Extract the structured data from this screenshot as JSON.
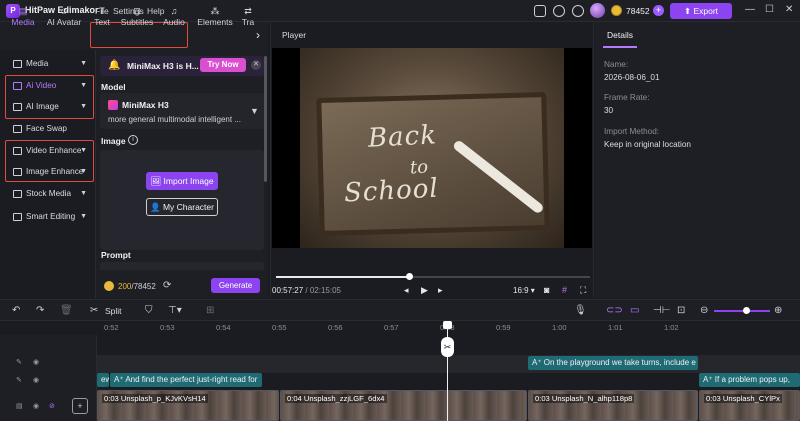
{
  "app": {
    "title": "HitPaw Edimakor",
    "logo": "P",
    "menu": [
      "File",
      "Settings",
      "Help"
    ]
  },
  "account": {
    "coins": "78452",
    "plus": "+",
    "export_label": "Export"
  },
  "left_tabs": [
    {
      "label": "Media",
      "icon": "media-icon"
    },
    {
      "label": "AI Avatar",
      "icon": "ai-avatar-icon"
    },
    {
      "label": "Text",
      "icon": "text-icon"
    },
    {
      "label": "Subtitles",
      "icon": "subtitles-icon"
    },
    {
      "label": "Audio",
      "icon": "audio-icon"
    },
    {
      "label": "Elements",
      "icon": "elements-icon"
    },
    {
      "label": "Tra",
      "icon": "transitions-icon"
    }
  ],
  "sidebar": [
    {
      "label": "Media"
    },
    {
      "label": "Ai Video"
    },
    {
      "label": "AI Image"
    },
    {
      "label": "Face Swap"
    },
    {
      "label": "Video Enhance"
    },
    {
      "label": "Image Enhance"
    },
    {
      "label": "Stock Media"
    },
    {
      "label": "Smart Editing"
    }
  ],
  "promo": {
    "text": "MiniMax H3 is H...",
    "cta": "Try Now"
  },
  "model": {
    "section": "Model",
    "name": "MiniMax H3",
    "desc": "more general multimodal intelligent ..."
  },
  "image_section": {
    "label": "Image",
    "import_label": "Import Image",
    "character_label": "My Character"
  },
  "prompt": {
    "label": "Prompt"
  },
  "credits": {
    "current": "200",
    "total": "/78452",
    "generate_label": "Generate"
  },
  "player": {
    "title": "Player",
    "current_time": "00:57:27",
    "duration": "/ 02:15:05",
    "ratio": "16:9",
    "progress": 0.42,
    "slate_line1": "Back",
    "slate_line2": "to",
    "slate_line3": "School"
  },
  "details": {
    "tab": "Details",
    "fields": [
      {
        "label": "Name:",
        "value": "2026-08-06_01"
      },
      {
        "label": "Frame Rate:",
        "value": "30"
      },
      {
        "label": "Import Method:",
        "value": "Keep in original location"
      }
    ]
  },
  "timeline": {
    "split_label": "Split",
    "ruler": [
      "0:52",
      "0:53",
      "0:54",
      "0:55",
      "0:56",
      "0:57",
      "0:58",
      "0:59",
      "1:00",
      "1:01",
      "1:02"
    ],
    "subtitles": [
      {
        "text": "ew"
      },
      {
        "text": "And find the perfect just-right read for"
      },
      {
        "text": "On the playground we take turns, include e"
      },
      {
        "text": "If a problem pops up,"
      }
    ],
    "video_clips": [
      {
        "label": "0:03 Unsplash_p_KJvKVsH14"
      },
      {
        "label": "0:04 Unsplash_zzjLGF_6dx4"
      },
      {
        "label": "0:03 Unsplash_N_alhp118p8"
      },
      {
        "label": "0:03 Unsplash_CYlPx"
      }
    ]
  },
  "colors": {
    "accent": "#8b44f0",
    "highlight_box": "#e24b3c",
    "subtitle_clip": "#1f6b73"
  }
}
